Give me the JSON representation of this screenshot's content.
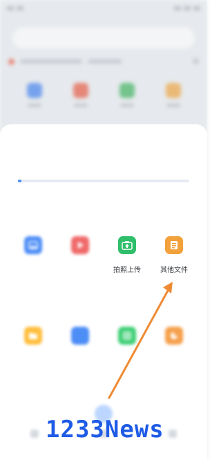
{
  "background": {
    "status": {
      "left": "...",
      "right": "..."
    },
    "search_placeholder": "...",
    "tiles": [
      {
        "icon": "image-icon",
        "color": "#3d7ff0"
      },
      {
        "icon": "video-icon",
        "color": "#e9553d"
      },
      {
        "icon": "doc-icon",
        "color": "#38b25a"
      },
      {
        "icon": "music-icon",
        "color": "#f0a23a"
      }
    ]
  },
  "sheet": {
    "title": "",
    "subtitle": "",
    "storage_progress": 0.02,
    "upload_section": {
      "label": "",
      "items": [
        {
          "label": "",
          "icon": "image-icon",
          "color": "#4d8df6"
        },
        {
          "label": "",
          "icon": "video-icon",
          "color": "#f06a6a"
        },
        {
          "label": "拍照上传",
          "icon": "camera-upload-icon",
          "color": "#2fbf6b"
        },
        {
          "label": "其他文件",
          "icon": "file-icon",
          "color": "#f2a13b"
        }
      ]
    },
    "new_section": {
      "label": "",
      "items": [
        {
          "label": "",
          "icon": "folder-icon",
          "color": "#ffbe3d"
        },
        {
          "label": "",
          "icon": "note-icon",
          "color": "#4d8df6"
        },
        {
          "label": "",
          "icon": "table-icon",
          "color": "#3fcf75"
        },
        {
          "label": "",
          "icon": "slide-icon",
          "color": "#f5a04c"
        }
      ]
    }
  },
  "annotation": {
    "arrow_color": "#ef8a34"
  },
  "watermark": "1233News"
}
